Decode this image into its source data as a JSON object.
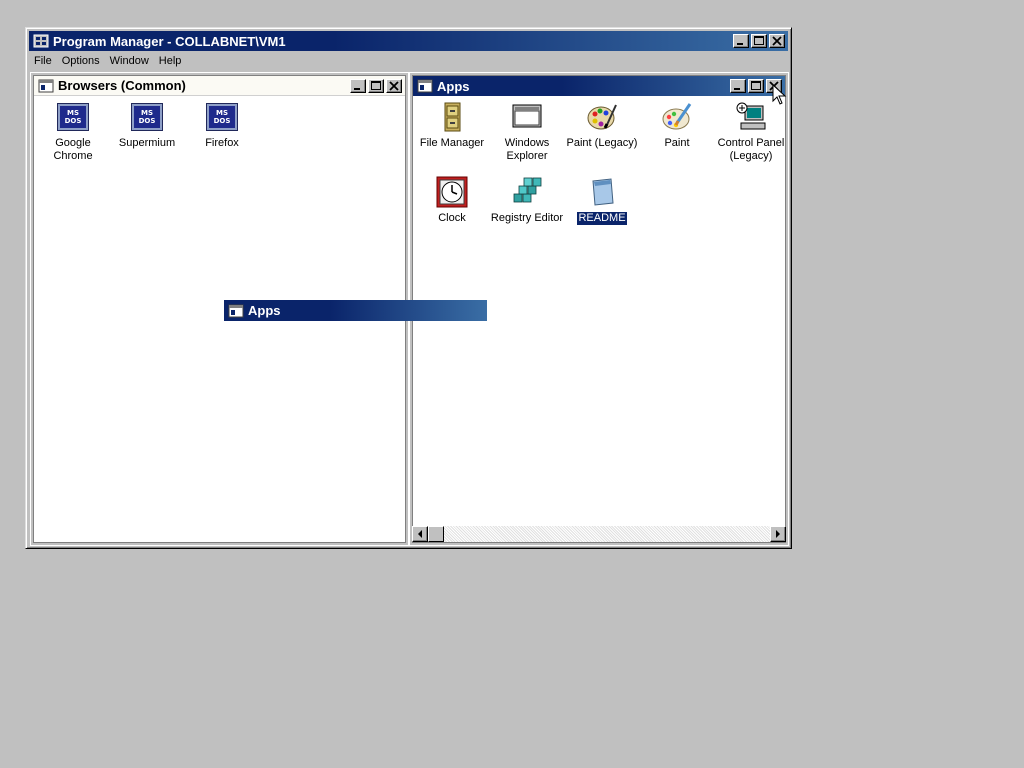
{
  "program_manager": {
    "title": "Program Manager - COLLABNET\\VM1",
    "menu": [
      "File",
      "Options",
      "Window",
      "Help"
    ]
  },
  "browsers_window": {
    "title": "Browsers (Common)",
    "icons": [
      {
        "label_lines": [
          "Google",
          "Chrome"
        ],
        "icon": "msdos-icon",
        "badge": "MS DOS"
      },
      {
        "label_lines": [
          "Supermium"
        ],
        "icon": "msdos-icon",
        "badge": "MS DOS"
      },
      {
        "label_lines": [
          "Firefox"
        ],
        "icon": "msdos-icon",
        "badge": "MS DOS"
      }
    ]
  },
  "apps_window": {
    "title": "Apps",
    "icons": [
      {
        "label_lines": [
          "File Manager"
        ],
        "icon": "file-cabinet-icon"
      },
      {
        "label_lines": [
          "Windows",
          "Explorer"
        ],
        "icon": "window-icon"
      },
      {
        "label_lines": [
          "Paint (Legacy)"
        ],
        "icon": "palette-icon"
      },
      {
        "label_lines": [
          "Paint"
        ],
        "icon": "palette-brush-icon"
      },
      {
        "label_lines": [
          "Control Panel",
          "(Legacy)"
        ],
        "icon": "control-panel-icon"
      },
      {
        "label_lines": [
          "Clock"
        ],
        "icon": "clock-icon"
      },
      {
        "label_lines": [
          "Registry Editor"
        ],
        "icon": "registry-cubes-icon"
      },
      {
        "label_lines": [
          "README"
        ],
        "icon": "notepad-icon",
        "selected": true
      }
    ]
  },
  "drag_outline": {
    "title": "Apps"
  },
  "colors": {
    "active_title": "#0a246a",
    "active_title_end": "#3a6ea5",
    "face": "#c0c0c0",
    "selection": "#0a246a"
  }
}
